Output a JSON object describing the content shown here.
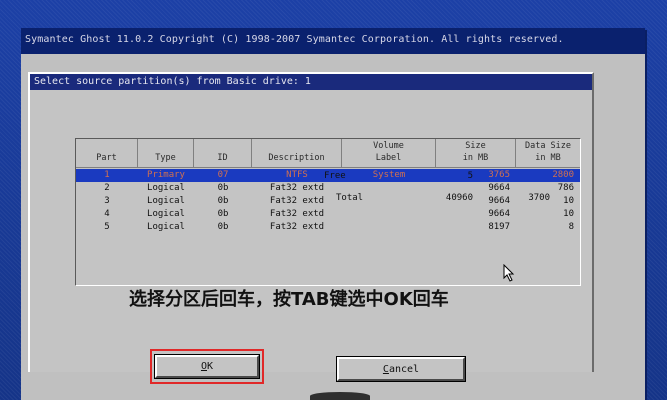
{
  "window": {
    "title": "Symantec Ghost 11.0.2   Copyright (C) 1998-2007 Symantec Corporation. All rights reserved."
  },
  "dialog": {
    "title": "Select source partition(s) from Basic drive: 1"
  },
  "table": {
    "headers": {
      "part": "Part",
      "type": "Type",
      "id": "ID",
      "description": "Description",
      "volume_label": "Volume\nLabel",
      "size": "Size\nin MB",
      "data_size": "Data Size\nin MB"
    },
    "rows": [
      {
        "part": "1",
        "type": "Primary",
        "id": "07",
        "description": "NTFS",
        "volume_label": "System",
        "size": "3765",
        "data_size": "2800",
        "selected": true
      },
      {
        "part": "2",
        "type": "Logical",
        "id": "0b",
        "description": "Fat32 extd",
        "volume_label": "",
        "size": "9664",
        "data_size": "786",
        "selected": false
      },
      {
        "part": "3",
        "type": "Logical",
        "id": "0b",
        "description": "Fat32 extd",
        "volume_label": "",
        "size": "9664",
        "data_size": "10",
        "selected": false
      },
      {
        "part": "4",
        "type": "Logical",
        "id": "0b",
        "description": "Fat32 extd",
        "volume_label": "",
        "size": "9664",
        "data_size": "10",
        "selected": false
      },
      {
        "part": "5",
        "type": "Logical",
        "id": "0b",
        "description": "Fat32 extd",
        "volume_label": "",
        "size": "8197",
        "data_size": "8",
        "selected": false
      }
    ],
    "free": {
      "label": "Free",
      "size": "5"
    },
    "total": {
      "label": "Total",
      "size": "40960",
      "data_size": "3700"
    }
  },
  "instruction": "选择分区后回车，按TAB键选中OK回车",
  "buttons": {
    "ok": {
      "accel": "O",
      "rest": "K"
    },
    "cancel": {
      "accel": "C",
      "rest": "ancel"
    }
  },
  "colors": {
    "desktop": "#1c3f9c",
    "window_title_bar": "#0a216e",
    "selection": "#1a3ac0",
    "highlight_box": "#e02828"
  },
  "icons": {
    "cursor": "mouse-pointer-icon"
  }
}
